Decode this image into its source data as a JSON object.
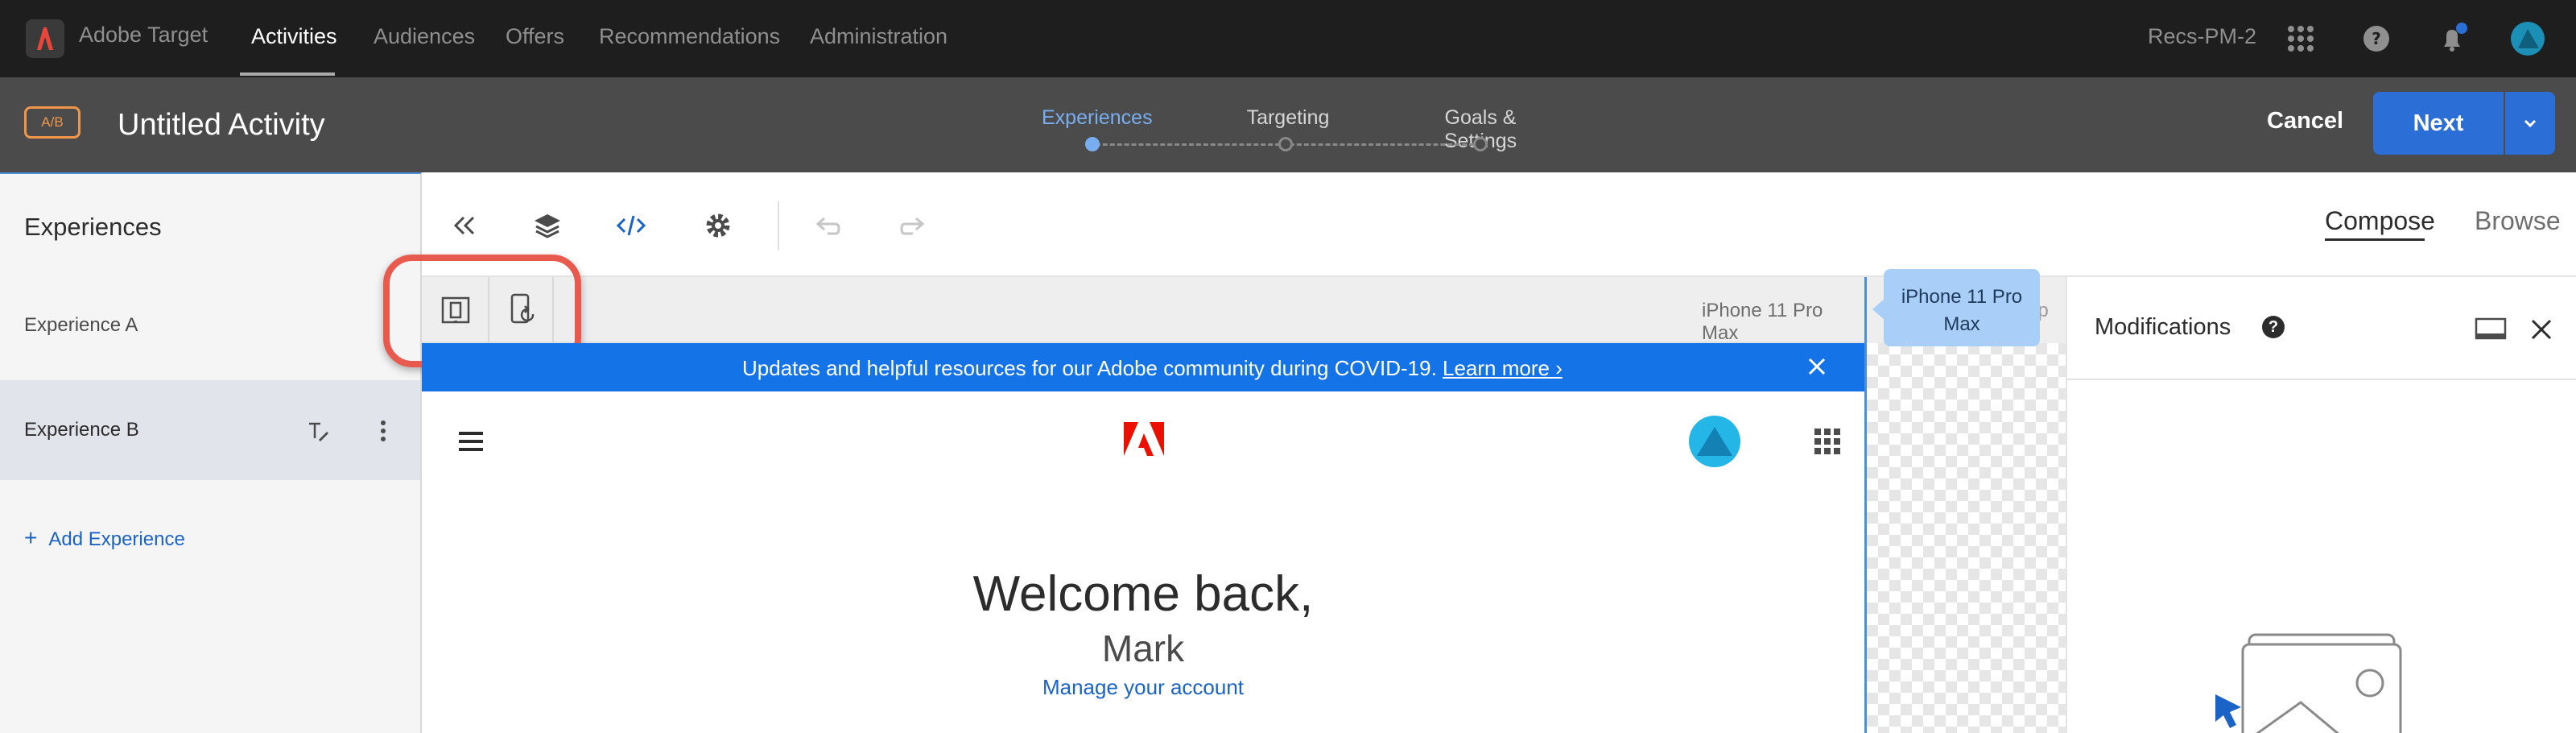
{
  "topbar": {
    "brand": "Adobe Target",
    "nav": [
      "Activities",
      "Audiences",
      "Offers",
      "Recommendations",
      "Administration"
    ],
    "active_nav": "Activities",
    "user": "Recs-PM-2"
  },
  "activity": {
    "badge": "A/B",
    "title": "Untitled Activity",
    "steps": [
      "Experiences",
      "Targeting",
      "Goals & Settings"
    ],
    "active_step": "Experiences",
    "cancel_label": "Cancel",
    "next_label": "Next"
  },
  "sidebar": {
    "title": "Experiences",
    "items": [
      {
        "label": "Experience A",
        "selected": false
      },
      {
        "label": "Experience B",
        "selected": true
      }
    ],
    "add_label": "Add Experience"
  },
  "toolbar": {
    "tabs": [
      "Compose",
      "Browse"
    ],
    "active_tab": "Compose"
  },
  "device": {
    "label": "iPhone 11 Pro Max",
    "partial_label": "op",
    "tooltip": "iPhone 11 Pro Max"
  },
  "preview": {
    "banner_text": "Updates and helpful resources for our Adobe community during COVID-19. ",
    "banner_link": "Learn more ›",
    "welcome": "Welcome back,",
    "name": "Mark",
    "manage": "Manage your account"
  },
  "modifications": {
    "title": "Modifications"
  },
  "colors": {
    "accent": "#2a6ed6",
    "banner": "#1473e6",
    "highlight": "#e95a4e",
    "badge": "#f0964a"
  }
}
